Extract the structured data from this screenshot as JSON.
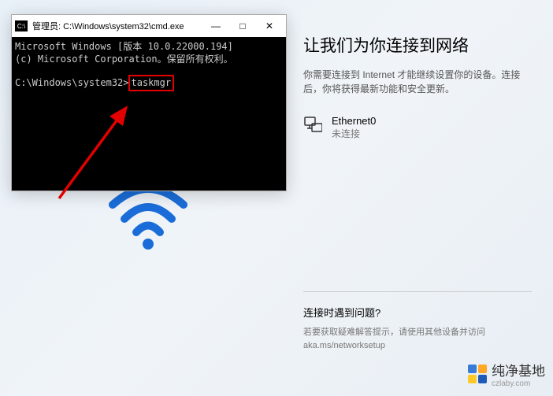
{
  "cmd": {
    "title": "管理员: C:\\Windows\\system32\\cmd.exe",
    "line1": "Microsoft Windows [版本 10.0.22000.194]",
    "line2": "(c) Microsoft Corporation。保留所有权利。",
    "prompt": "C:\\Windows\\system32>",
    "command": "taskmgr",
    "minimize": "—",
    "maximize": "□",
    "close": "✕"
  },
  "network": {
    "title": "让我们为你连接到网络",
    "description": "你需要连接到 Internet 才能继续设置你的设备。连接后，你将获得最新功能和安全更新。",
    "adapter_name": "Ethernet0",
    "adapter_status": "未连接"
  },
  "help": {
    "title": "连接时遇到问题?",
    "text": "若要获取疑难解答提示，请使用其他设备并访问 aka.ms/networksetup"
  },
  "watermark": {
    "brand": "纯净基地",
    "url": "czlaby.com"
  }
}
